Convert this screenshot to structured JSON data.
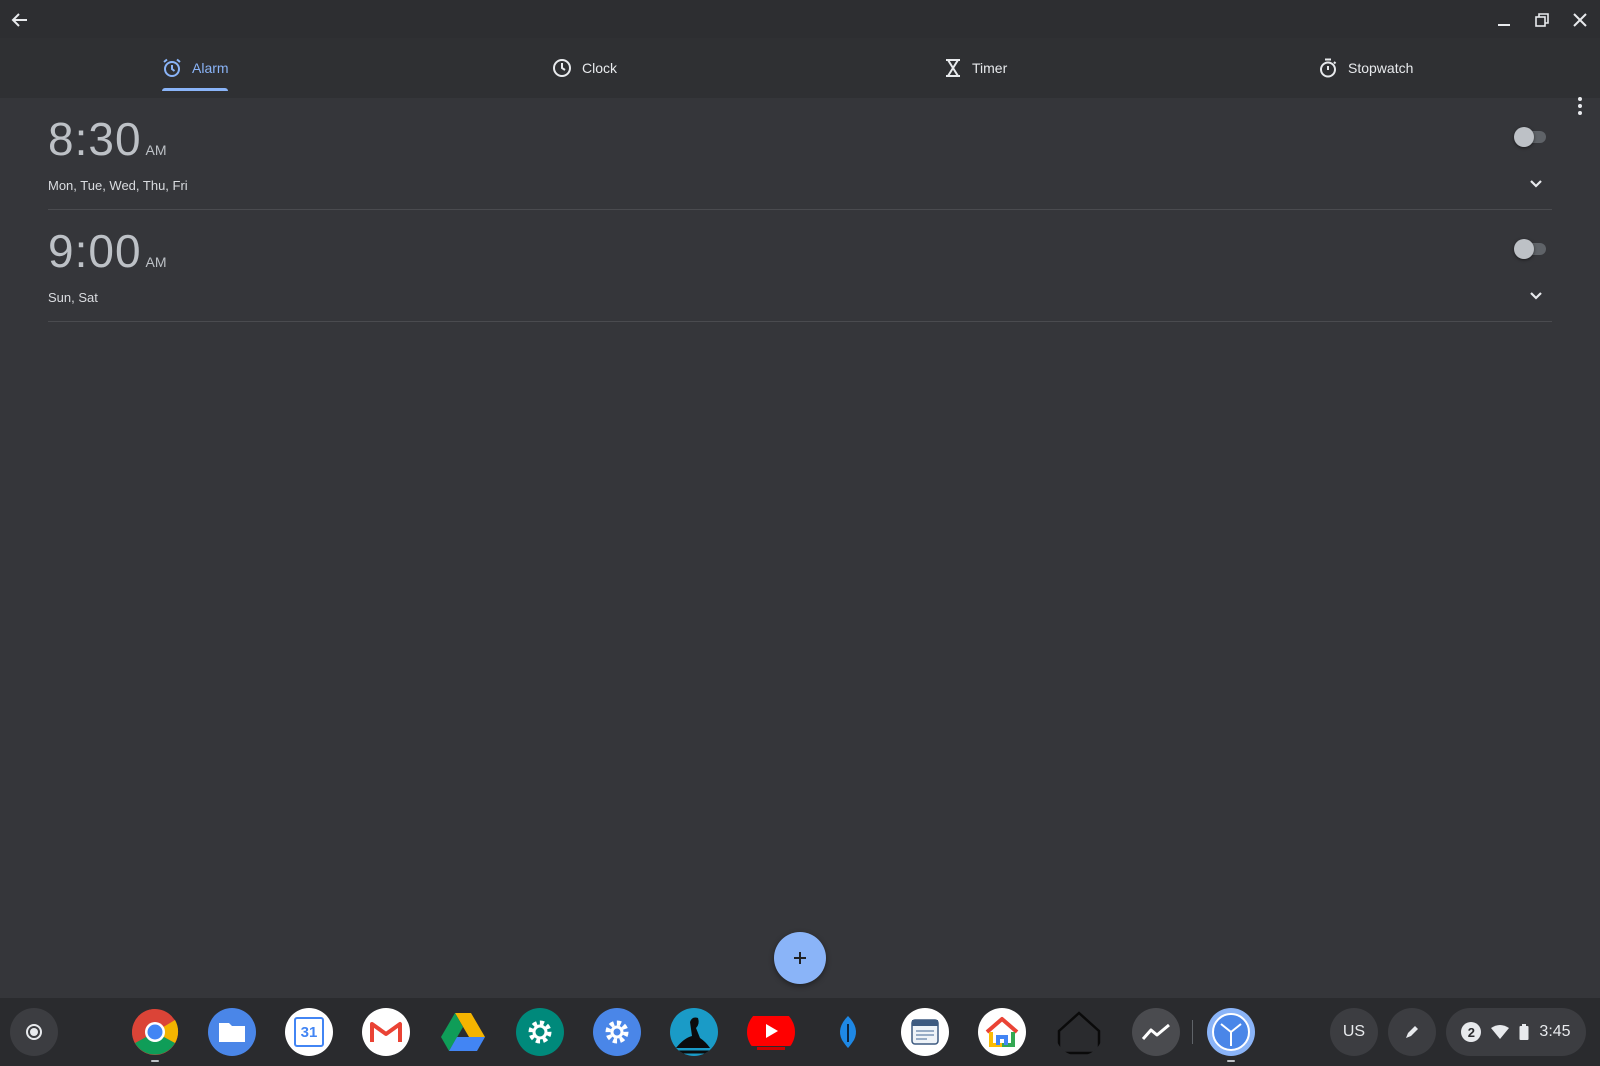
{
  "tabs": [
    {
      "label": "Alarm",
      "active": true,
      "icon": "alarm-icon"
    },
    {
      "label": "Clock",
      "active": false,
      "icon": "clock-icon"
    },
    {
      "label": "Timer",
      "active": false,
      "icon": "hourglass-icon"
    },
    {
      "label": "Stopwatch",
      "active": false,
      "icon": "stopwatch-icon"
    }
  ],
  "alarms": [
    {
      "time": "8:30",
      "ampm": "AM",
      "days": "Mon, Tue, Wed, Thu, Fri",
      "enabled": false
    },
    {
      "time": "9:00",
      "ampm": "AM",
      "days": "Sun, Sat",
      "enabled": false
    }
  ],
  "shelf": {
    "apps": [
      "Chrome",
      "Files",
      "Calendar",
      "Gmail",
      "Drive",
      "Settings",
      "Play settings",
      "Kindle",
      "YouTube",
      "Pen",
      "Notes",
      "Google Home",
      "Home",
      "Activity",
      "Clock"
    ],
    "calendar_day": "31",
    "keyboard_layout": "US",
    "notification_count": "2",
    "time": "3:45"
  },
  "colors": {
    "accent": "#8ab4f8",
    "background": "#35363a",
    "tabbar": "#2f3033",
    "shelf": "#2a2b2e"
  }
}
